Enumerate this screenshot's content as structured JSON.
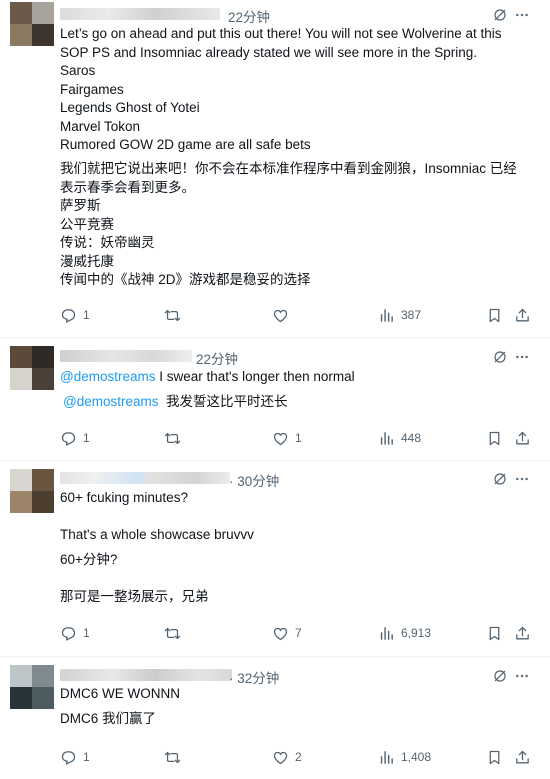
{
  "colors": {
    "text": "#0f1419",
    "secondary": "#536471",
    "mention": "#1d9bf0",
    "divider": "#eff3f4"
  },
  "posts": [
    {
      "time": "22分钟",
      "lines": [
        "Let’s go on ahead and put this out there! You will not see Wolverine at this",
        "SOP PS and Insomniac already stated we will see more in the Spring.",
        "Saros",
        "Fairgames",
        "Legends Ghost of Yotei",
        "Marvel Tokon",
        "Rumored GOW 2D game are all safe bets"
      ],
      "translation": [
        "我们就把它说出来吧！你不会在本标准作程序中看到金刚狼，Insomniac 已经",
        "表示春季会看到更多。",
        "萨罗斯",
        "公平竞赛",
        "传说：妖帝幽灵",
        "漫威托康",
        "传闻中的《战神 2D》游戏都是稳妥的选择"
      ],
      "replies": "1",
      "likes": "",
      "views": "387"
    },
    {
      "time": "22分钟",
      "mention": "@demostreams",
      "text": "I swear that's longer then normal",
      "translation_mention": "@demostreams",
      "translation": "我发誓这比平时还长",
      "replies": "1",
      "likes": "1",
      "views": "448"
    },
    {
      "time": "· 30分钟",
      "lines": [
        "60+ fcuking minutes?",
        "That's a whole showcase bruvvv"
      ],
      "translation": [
        "60+分钟?",
        "那可是一整场展示，兄弟"
      ],
      "replies": "1",
      "likes": "7",
      "views": "6,913"
    },
    {
      "time": "· 32分钟",
      "lines": [
        "DMC6 WE WONNN"
      ],
      "translation": [
        "DMC6 我们赢了"
      ],
      "replies": "1",
      "likes": "2",
      "views": "1,408"
    }
  ],
  "icons": [
    "reply-icon",
    "repost-icon",
    "like-icon",
    "views-icon",
    "bookmark-icon",
    "share-icon",
    "grok-icon",
    "more-icon"
  ]
}
